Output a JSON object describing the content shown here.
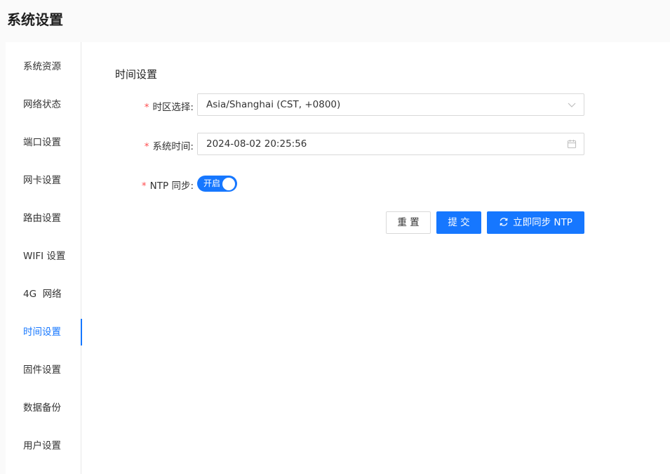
{
  "page": {
    "title": "系统设置"
  },
  "sidebar": {
    "items": [
      {
        "label": "系统资源"
      },
      {
        "label": "网络状态"
      },
      {
        "label": "端口设置"
      },
      {
        "label": "网卡设置"
      },
      {
        "label": "路由设置"
      },
      {
        "label": "WIFI 设置"
      },
      {
        "label": "4G  网络"
      },
      {
        "label": "时间设置",
        "active": true
      },
      {
        "label": "固件设置"
      },
      {
        "label": "数据备份"
      },
      {
        "label": "用户设置"
      }
    ]
  },
  "form": {
    "section_title": "时间设置",
    "required_mark": "*",
    "timezone": {
      "label": "时区选择:",
      "value": "Asia/Shanghai (CST, +0800)",
      "icon": "chevron-down-icon"
    },
    "system_time": {
      "label": "系统时间:",
      "value": "2024-08-02 20:25:56",
      "icon": "calendar-icon"
    },
    "ntp_sync": {
      "label": "NTP 同步:",
      "switch_text": "开启",
      "enabled": true
    },
    "buttons": {
      "reset": "重 置",
      "submit": "提 交",
      "sync_now": "立即同步 NTP"
    }
  },
  "colors": {
    "primary": "#1677ff",
    "required": "#ff4d4f"
  }
}
